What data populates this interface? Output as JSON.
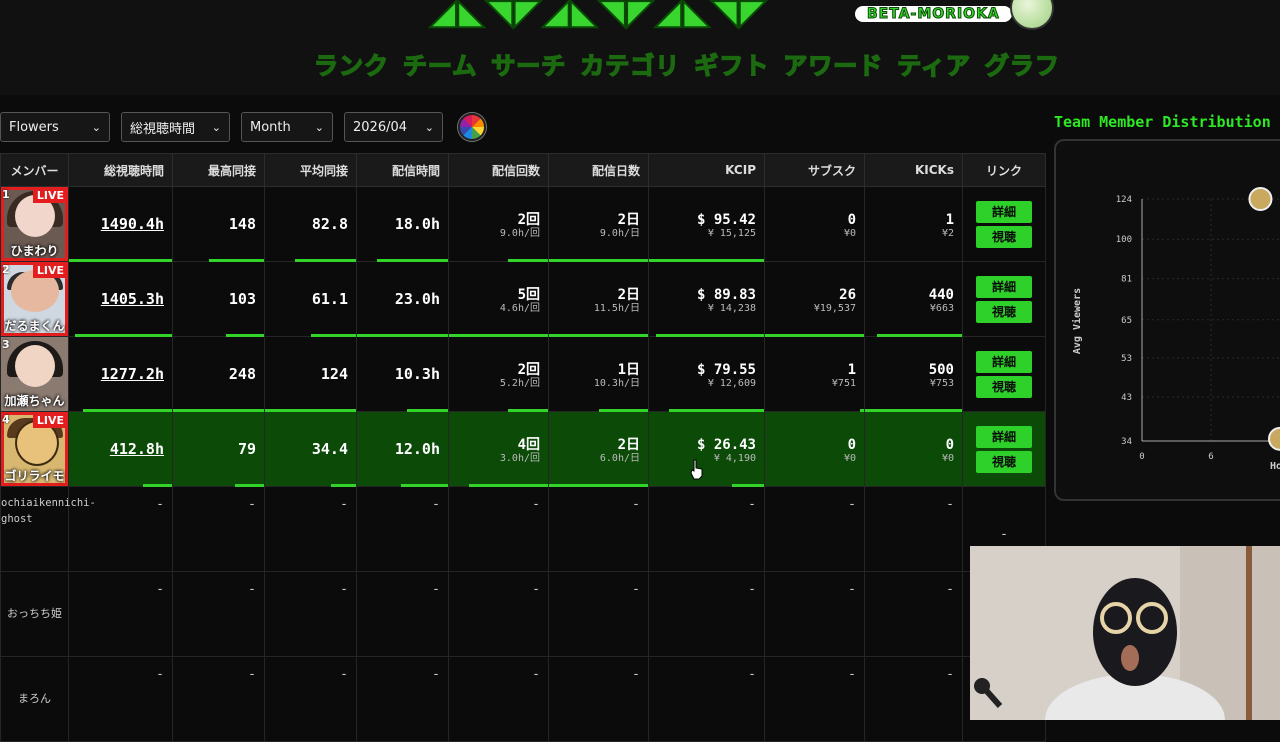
{
  "header": {
    "logo_sub": "BETA-MORIOKA",
    "nav": [
      {
        "label": "ランク"
      },
      {
        "label": "チーム"
      },
      {
        "label": "サーチ"
      },
      {
        "label": "カテゴリ"
      },
      {
        "label": "ギフト"
      },
      {
        "label": "アワード"
      },
      {
        "label": "ティア"
      },
      {
        "label": "グラフ"
      }
    ],
    "active_nav": "チーム"
  },
  "filters": {
    "team": "Flowers",
    "metric": "総視聴時間",
    "period": "Month",
    "month": "2026/04"
  },
  "table": {
    "headers": {
      "member": "メンバー",
      "total_hours": "総視聴時間",
      "peak": "最高同接",
      "avg": "平均同接",
      "stream_time": "配信時間",
      "stream_count": "配信回数",
      "stream_days": "配信日数",
      "kcip": "KCIP",
      "subs": "サブスク",
      "kicks": "KICKs",
      "links": "リンク"
    },
    "rows": [
      {
        "rank": "1",
        "name": "ひまわり",
        "live": "LIVE",
        "total_hours": "1490.4h",
        "peak": "148",
        "avg": "82.8",
        "stream_time": "18.0h",
        "count": "2回",
        "count_sub": "9.0h/回",
        "days": "2日",
        "days_sub": "9.0h/日",
        "kcip": "$ 95.42",
        "kcip_sub": "¥ 15,125",
        "subs": "0",
        "subs_sub": "¥0",
        "kicks": "1",
        "kicks_sub": "¥2",
        "btn_detail": "詳細",
        "btn_watch": "視聴"
      },
      {
        "rank": "2",
        "name": "だるまくん",
        "live": "LIVE",
        "total_hours": "1405.3h",
        "peak": "103",
        "avg": "61.1",
        "stream_time": "23.0h",
        "count": "5回",
        "count_sub": "4.6h/回",
        "days": "2日",
        "days_sub": "11.5h/日",
        "kcip": "$ 89.83",
        "kcip_sub": "¥ 14,238",
        "subs": "26",
        "subs_sub": "¥19,537",
        "kicks": "440",
        "kicks_sub": "¥663",
        "btn_detail": "詳細",
        "btn_watch": "視聴"
      },
      {
        "rank": "3",
        "name": "加瀬ちゃん",
        "live": "",
        "total_hours": "1277.2h",
        "peak": "248",
        "avg": "124",
        "stream_time": "10.3h",
        "count": "2回",
        "count_sub": "5.2h/回",
        "days": "1日",
        "days_sub": "10.3h/日",
        "kcip": "$ 79.55",
        "kcip_sub": "¥ 12,609",
        "subs": "1",
        "subs_sub": "¥751",
        "kicks": "500",
        "kicks_sub": "¥753",
        "btn_detail": "詳細",
        "btn_watch": "視聴"
      },
      {
        "rank": "4",
        "name": "ゴリライモ",
        "live": "LIVE",
        "total_hours": "412.8h",
        "peak": "79",
        "avg": "34.4",
        "stream_time": "12.0h",
        "count": "4回",
        "count_sub": "3.0h/回",
        "days": "2日",
        "days_sub": "6.0h/日",
        "kcip": "$ 26.43",
        "kcip_sub": "¥ 4,190",
        "subs": "0",
        "subs_sub": "¥0",
        "kicks": "0",
        "kicks_sub": "¥0",
        "btn_detail": "詳細",
        "btn_watch": "視聴"
      }
    ],
    "empty_rows": [
      {
        "name": "ochiaikennichi-\nghost",
        "dash": "-"
      },
      {
        "name": "おっちち姫",
        "dash": "-"
      },
      {
        "name": "まろん",
        "dash": "-"
      }
    ]
  },
  "chart": {
    "title": "Team Member Distribution",
    "ylabel": "Avg Viewers",
    "xlabel": "Hours",
    "y_ticks": [
      "124",
      "100",
      "81",
      "65",
      "53",
      "43",
      "34"
    ],
    "x_ticks": [
      "0",
      "6",
      "1"
    ]
  },
  "chart_data": {
    "type": "scatter",
    "title": "Team Member Distribution",
    "xlabel": "Hours",
    "ylabel": "Avg Viewers",
    "y_scale": "log",
    "y_ticks": [
      124,
      100,
      81,
      65,
      53,
      43,
      34
    ],
    "x_ticks": [
      0,
      6
    ],
    "points": [
      {
        "label": "加瀬ちゃん",
        "x": 10.3,
        "y": 124
      },
      {
        "label": "ゴリライモ",
        "x": 12.0,
        "y": 34.4
      }
    ]
  },
  "colors": {
    "accent": "#2ee825",
    "own_row": "#0b4a07",
    "live": "#e41e1e"
  }
}
